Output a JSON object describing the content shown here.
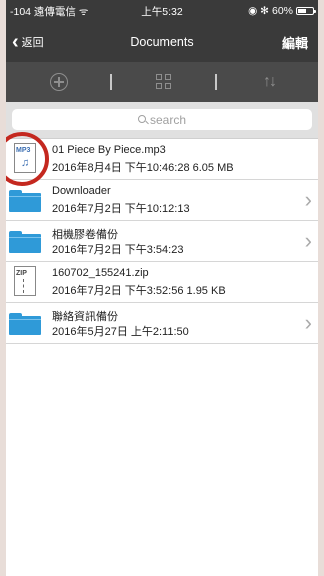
{
  "status_bar": {
    "carrier": "-104 遠傳電信 ᯤ",
    "time": "上午5:32",
    "right_icons": "◉ ✻",
    "battery_text": "60%",
    "battery_level": 0.6
  },
  "nav": {
    "back_label": "返回",
    "title": "Documents",
    "edit_label": "編輯"
  },
  "toolbar": {
    "sort_glyph": "↑↓"
  },
  "search": {
    "placeholder": "search"
  },
  "files": [
    {
      "type": "mp3",
      "icon_label": "MP3",
      "name": "01 Piece By Piece.mp3",
      "meta": "2016年8月4日 下午10:46:28  6.05 MB"
    },
    {
      "type": "folder",
      "name": "Downloader",
      "meta": "2016年7月2日 下午10:12:13"
    },
    {
      "type": "folder",
      "name": "相機膠卷備份",
      "meta": "2016年7月2日 下午3:54:23"
    },
    {
      "type": "zip",
      "icon_label": "ZIP",
      "name": "160702_155241.zip",
      "meta": "2016年7月2日 下午3:52:56  1.95 KB"
    },
    {
      "type": "folder",
      "name": "聯絡資訊備份",
      "meta": "2016年5月27日 上午2:11:50"
    }
  ],
  "colors": {
    "nav_bg": "#3a3a3a",
    "toolbar_bg": "#4a4a4a",
    "folder_blue": "#2f9ad8",
    "highlight_circle": "#c4281f"
  }
}
